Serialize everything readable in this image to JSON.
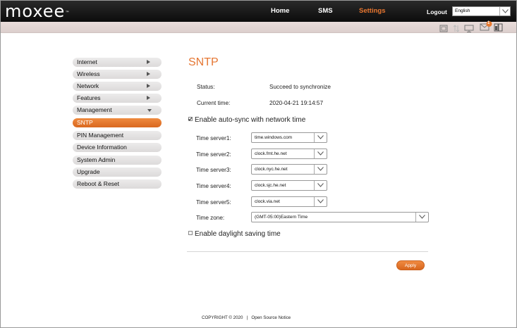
{
  "header": {
    "logo": "moxee",
    "logo_mark": "™",
    "nav": [
      {
        "label": "Home"
      },
      {
        "label": "SMS"
      },
      {
        "label": "Settings"
      }
    ],
    "logout": "Logout",
    "language": "English",
    "accent_color": "#e57632"
  },
  "status_icons": [
    "sim-card-icon",
    "signal-arrows-icon",
    "monitor-icon",
    "message-icon",
    "battery-icon"
  ],
  "status_badge": "1",
  "sidebar": {
    "items": [
      {
        "label": "Internet"
      },
      {
        "label": "Wireless"
      },
      {
        "label": "Network"
      },
      {
        "label": "Features"
      },
      {
        "label": "Management"
      },
      {
        "label": "SNTP"
      },
      {
        "label": "PIN Management"
      },
      {
        "label": "Device Information"
      },
      {
        "label": "System Admin"
      },
      {
        "label": "Upgrade"
      },
      {
        "label": "Reboot & Reset"
      }
    ]
  },
  "main": {
    "title": "SNTP",
    "status_label": "Status:",
    "status_value": "Succeed to synchronize",
    "time_label": "Current time:",
    "time_value": "2020-04-21 19:14:57",
    "auto_sync_label": "Enable auto-sync with network time",
    "auto_sync_checked": true,
    "servers": [
      {
        "label": "Time server1:",
        "value": "time.windows.com"
      },
      {
        "label": "Time server2:",
        "value": "clock.fmt.he.net"
      },
      {
        "label": "Time server3:",
        "value": "clock.nyc.he.net"
      },
      {
        "label": "Time server4:",
        "value": "clock.sjc.he.net"
      },
      {
        "label": "Time server5:",
        "value": "clock.via.net"
      }
    ],
    "timezone_label": "Time zone:",
    "timezone_value": "(GMT-05:00)Eastern Time",
    "dst_label": "Enable daylight saving time",
    "dst_checked": false,
    "apply_label": "Apply"
  },
  "footer": {
    "copyright": "COPYRIGHT © 2020",
    "separator": "|",
    "notice": "Open Source Notice"
  }
}
